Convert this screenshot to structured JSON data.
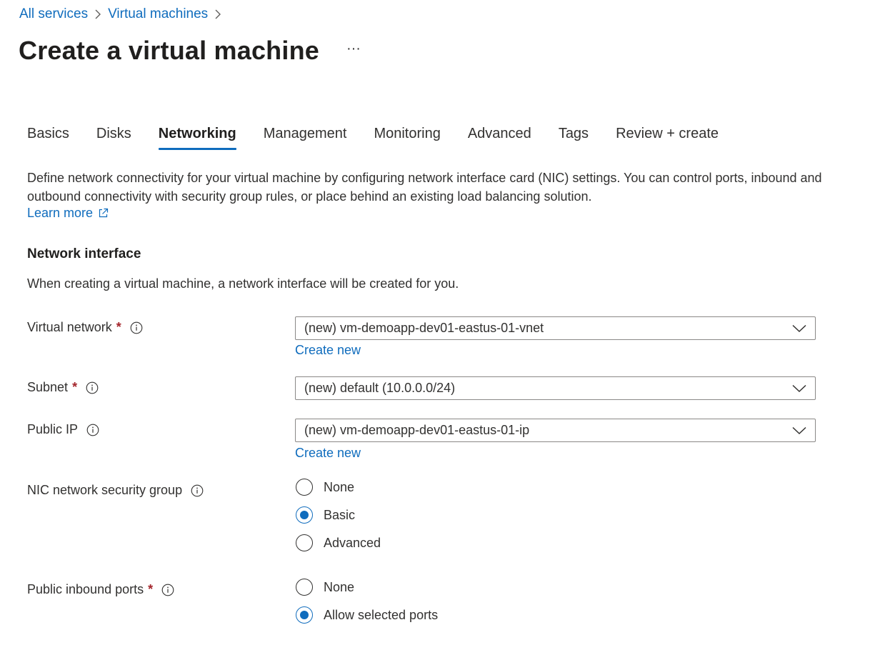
{
  "breadcrumb": {
    "items": [
      "All services",
      "Virtual machines"
    ]
  },
  "header": {
    "title": "Create a virtual machine",
    "more": "···"
  },
  "tabs": [
    {
      "label": "Basics",
      "active": false
    },
    {
      "label": "Disks",
      "active": false
    },
    {
      "label": "Networking",
      "active": true
    },
    {
      "label": "Management",
      "active": false
    },
    {
      "label": "Monitoring",
      "active": false
    },
    {
      "label": "Advanced",
      "active": false
    },
    {
      "label": "Tags",
      "active": false
    },
    {
      "label": "Review + create",
      "active": false
    }
  ],
  "main": {
    "description": "Define network connectivity for your virtual machine by configuring network interface card (NIC) settings. You can control ports, inbound and outbound connectivity with security group rules, or place behind an existing load balancing solution.",
    "learn_more": "Learn more",
    "section": {
      "title": "Network interface",
      "description": "When creating a virtual machine, a network interface will be created for you."
    },
    "fields": {
      "virtual_network": {
        "label": "Virtual network",
        "required": "*",
        "value": "(new) vm-demoapp-dev01-eastus-01-vnet",
        "create_new": "Create new"
      },
      "subnet": {
        "label": "Subnet",
        "required": "*",
        "value": "(new) default (10.0.0.0/24)"
      },
      "public_ip": {
        "label": "Public IP",
        "value": "(new) vm-demoapp-dev01-eastus-01-ip",
        "create_new": "Create new"
      },
      "nic_nsg": {
        "label": "NIC network security group",
        "options": [
          "None",
          "Basic",
          "Advanced"
        ],
        "selected": "Basic"
      },
      "public_inbound_ports": {
        "label": "Public inbound ports",
        "required": "*",
        "options": [
          "None",
          "Allow selected ports"
        ],
        "selected": "Allow selected ports"
      }
    }
  },
  "colors": {
    "accent": "#0f6cbd",
    "required": "#a4262c",
    "text": "#323130"
  },
  "icons": {
    "chevron": "chevron-right-icon",
    "info": "info-icon",
    "dropdown": "chevron-down-icon",
    "external": "external-link-icon"
  }
}
